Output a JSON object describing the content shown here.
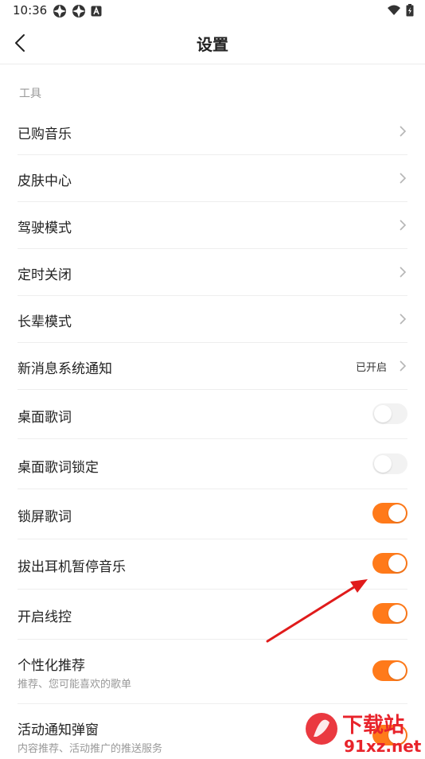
{
  "status_bar": {
    "time": "10:36"
  },
  "header": {
    "title": "设置"
  },
  "section": {
    "label": "工具"
  },
  "rows": [
    {
      "title": "已购音乐"
    },
    {
      "title": "皮肤中心"
    },
    {
      "title": "驾驶模式"
    },
    {
      "title": "定时关闭"
    },
    {
      "title": "长辈模式"
    },
    {
      "title": "新消息系统通知",
      "status": "已开启"
    },
    {
      "title": "桌面歌词",
      "on": false
    },
    {
      "title": "桌面歌词锁定",
      "on": false
    },
    {
      "title": "锁屏歌词",
      "on": true
    },
    {
      "title": "拔出耳机暂停音乐",
      "on": true
    },
    {
      "title": "开启线控",
      "on": true
    },
    {
      "title": "个性化推荐",
      "subtitle": "推荐、您可能喜欢的歌单",
      "on": true
    },
    {
      "title": "活动通知弹窗",
      "subtitle": "内容推荐、活动推广的推送服务",
      "on": true
    }
  ],
  "watermark": {
    "text": "下载站",
    "domain": "91xz.net"
  },
  "colors": {
    "accent": "#ff7a1a",
    "arrow": "#e01b1b"
  }
}
